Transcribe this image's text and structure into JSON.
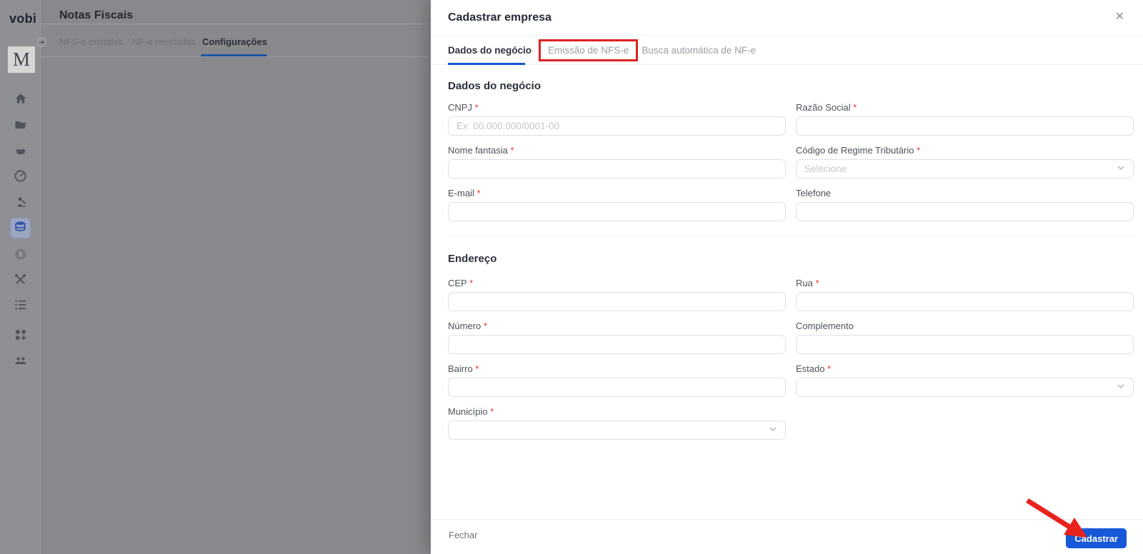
{
  "colors": {
    "accent_blue": "#1557d0",
    "button_blue": "#1758d8",
    "annotation_red": "#e02222",
    "required_red": "#f23030",
    "overlay_gray": "#88898c"
  },
  "icons": {
    "close": "✕",
    "collapse": "⇥"
  },
  "underlay": {
    "logo": "vobi",
    "avatar_monogram": "M",
    "page_title": "Notas Fiscais",
    "tabs": [
      {
        "label": "NFS-e emitidas",
        "active": false
      },
      {
        "label": "NF-e recebidas",
        "active": false
      },
      {
        "label": "Configurações",
        "active": true
      }
    ],
    "sidebar_items": [
      {
        "id": "home",
        "icon": "home",
        "active": false
      },
      {
        "id": "projects",
        "icon": "folder",
        "active": false
      },
      {
        "id": "deals",
        "icon": "handshake",
        "active": false
      },
      {
        "id": "dashboard",
        "icon": "gauge",
        "active": false
      },
      {
        "id": "construction",
        "icon": "worker",
        "active": false
      },
      {
        "id": "fiscal-notes",
        "icon": "database",
        "active": true
      },
      {
        "id": "finance",
        "icon": "dollar",
        "active": false
      },
      {
        "id": "tools",
        "icon": "tools",
        "active": false
      },
      {
        "id": "lists",
        "icon": "list",
        "active": false
      },
      {
        "id": "apps",
        "icon": "grid-plus",
        "active": false
      },
      {
        "id": "clients",
        "icon": "people",
        "active": false
      }
    ]
  },
  "drawer": {
    "title": "Cadastrar empresa",
    "tabs": [
      {
        "label": "Dados do negócio",
        "active": true,
        "annotated": false
      },
      {
        "label": "Emissão de NFS-e",
        "active": false,
        "annotated": true
      },
      {
        "label": "Busca automática de NF-e",
        "active": false,
        "annotated": false
      }
    ],
    "sections": [
      {
        "heading": "Dados do negócio",
        "fields": [
          {
            "label": "CNPJ",
            "required": true,
            "type": "input",
            "placeholder": "Ex: 00.000.000/0001-00",
            "value": ""
          },
          {
            "label": "Razão Social",
            "required": true,
            "type": "input",
            "placeholder": "",
            "value": ""
          },
          {
            "label": "Nome fantasia",
            "required": true,
            "type": "input",
            "placeholder": "",
            "value": ""
          },
          {
            "label": "Código de Regime Tributário",
            "required": true,
            "type": "select",
            "placeholder": "Selecione"
          },
          {
            "label": "E-mail",
            "required": true,
            "type": "input",
            "placeholder": "",
            "value": ""
          },
          {
            "label": "Telefone",
            "required": false,
            "type": "input",
            "placeholder": "",
            "value": ""
          }
        ]
      },
      {
        "heading": "Endereço",
        "fields": [
          {
            "label": "CEP",
            "required": true,
            "type": "input",
            "placeholder": "",
            "value": ""
          },
          {
            "label": "Rua",
            "required": true,
            "type": "input",
            "placeholder": "",
            "value": ""
          },
          {
            "label": "Número",
            "required": true,
            "type": "input",
            "placeholder": "",
            "value": ""
          },
          {
            "label": "Complemento",
            "required": false,
            "type": "input",
            "placeholder": "",
            "value": ""
          },
          {
            "label": "Bairro",
            "required": true,
            "type": "input",
            "placeholder": "",
            "value": ""
          },
          {
            "label": "Estado",
            "required": true,
            "type": "select",
            "placeholder": ""
          },
          {
            "label": "Município",
            "required": true,
            "type": "select",
            "placeholder": "",
            "half": true
          }
        ]
      }
    ],
    "footer": {
      "close_label": "Fechar",
      "submit_label": "Cadastrar"
    }
  }
}
